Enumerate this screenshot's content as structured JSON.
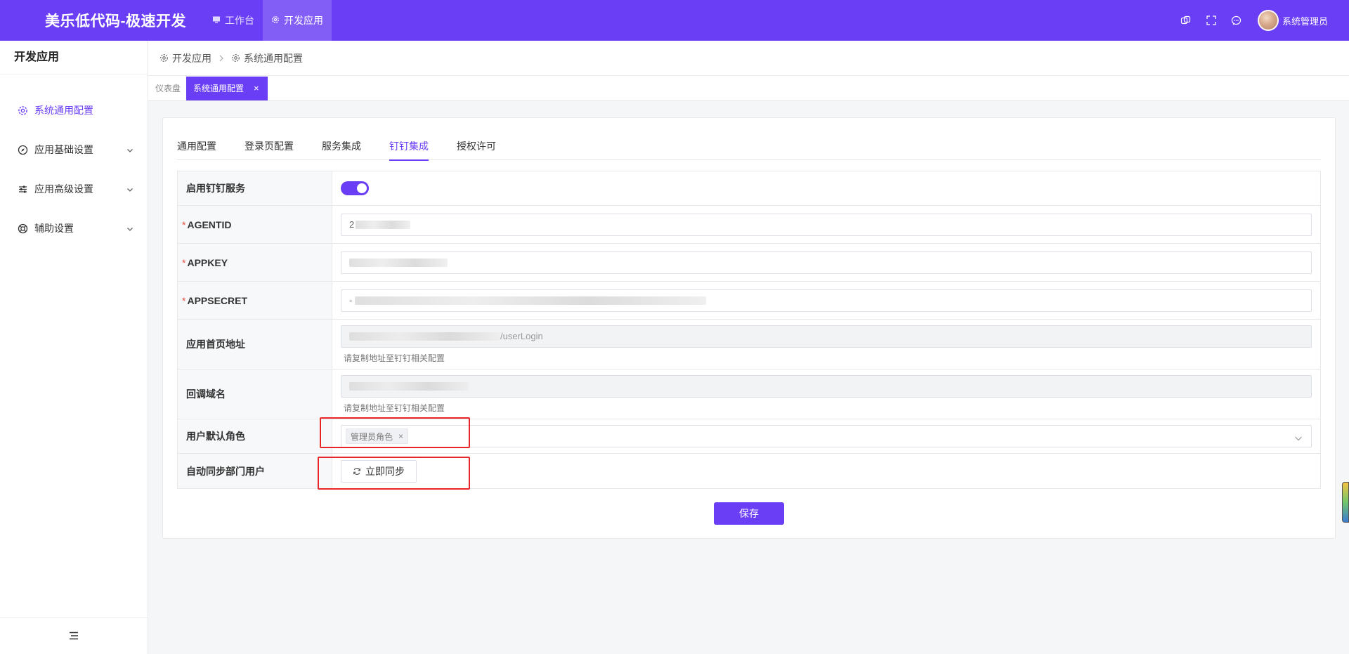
{
  "app": {
    "brand": "美乐低代码-极速开发"
  },
  "topnav": [
    {
      "label": "工作台",
      "icon": "monitor-icon",
      "active": false
    },
    {
      "label": "开发应用",
      "icon": "gear-icon",
      "active": true
    }
  ],
  "topright": {
    "icons": [
      "window-icon",
      "fullscreen-icon",
      "message-icon"
    ],
    "user": "系统管理员"
  },
  "sidebar": {
    "title": "开发应用",
    "items": [
      {
        "label": "系统通用配置",
        "icon": "gear-icon",
        "active": true,
        "expandable": false
      },
      {
        "label": "应用基础设置",
        "icon": "compass-icon",
        "active": false,
        "expandable": true
      },
      {
        "label": "应用高级设置",
        "icon": "sliders-icon",
        "active": false,
        "expandable": true
      },
      {
        "label": "辅助设置",
        "icon": "lifebuoy-icon",
        "active": false,
        "expandable": true
      }
    ],
    "footer_icon": "menu-fold-icon"
  },
  "breadcrumb": [
    "开发应用",
    "系统通用配置"
  ],
  "tagbar": {
    "home": "仪表盘",
    "active": "系统通用配置"
  },
  "tabs": [
    {
      "label": "通用配置",
      "active": false
    },
    {
      "label": "登录页配置",
      "active": false
    },
    {
      "label": "服务集成",
      "active": false
    },
    {
      "label": "钉钉集成",
      "active": true
    },
    {
      "label": "授权许可",
      "active": false
    }
  ],
  "form": {
    "enable_label": "启用钉钉服务",
    "enable_value": true,
    "agentid_label": "AGENTID",
    "agentid_prefix": "2",
    "appkey_label": "APPKEY",
    "appsecret_label": "APPSECRET",
    "appsecret_prefix": "-",
    "homepage_label": "应用首页地址",
    "homepage_suffix": "/userLogin",
    "homepage_hint": "请复制地址至钉钉相关配置",
    "callback_label": "回调域名",
    "callback_hint": "请复制地址至钉钉相关配置",
    "role_label": "用户默认角色",
    "role_chip": "管理员角色",
    "sync_label": "自动同步部门用户",
    "sync_button": "立即同步"
  },
  "save_button": "保存",
  "colors": {
    "primary": "#6a3ef5",
    "highlight": "#e8262a"
  }
}
